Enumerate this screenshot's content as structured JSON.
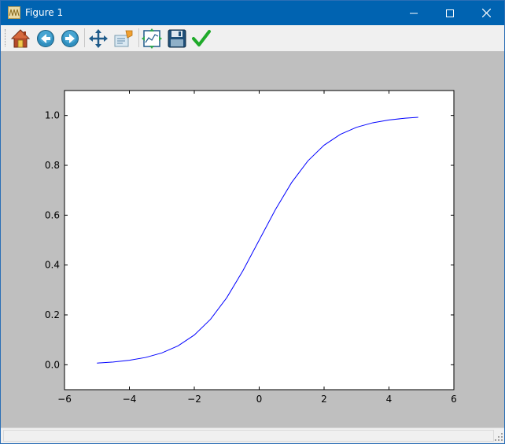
{
  "window": {
    "title": "Figure 1",
    "titlebar_color": "#0063b1",
    "icons": {
      "app": "figure-app-icon",
      "minimize": "minimize-icon",
      "maximize": "maximize-icon",
      "close": "close-icon"
    }
  },
  "toolbar": {
    "tools": [
      {
        "id": "home",
        "icon": "home-icon"
      },
      {
        "id": "back",
        "icon": "back-arrow-icon"
      },
      {
        "id": "forward",
        "icon": "forward-arrow-icon"
      },
      {
        "id": "pan",
        "icon": "pan-move-icon"
      },
      {
        "id": "zoom",
        "icon": "zoom-rectangle-icon"
      },
      {
        "id": "subplots",
        "icon": "configure-subplots-icon"
      },
      {
        "id": "save",
        "icon": "save-floppy-icon"
      },
      {
        "id": "edit",
        "icon": "edit-parameters-check-icon"
      }
    ]
  },
  "figure": {
    "background": "#bfbfbf",
    "axes_background": "#ffffff",
    "line_color": "#0000ff"
  },
  "chart_data": {
    "type": "line",
    "title": "",
    "xlabel": "",
    "ylabel": "",
    "xlim": [
      -6,
      6
    ],
    "ylim": [
      -0.1,
      1.1
    ],
    "xticks": [
      -6,
      -4,
      -2,
      0,
      2,
      4,
      6
    ],
    "xtick_labels": [
      "−6",
      "−4",
      "−2",
      "0",
      "2",
      "4",
      "6"
    ],
    "yticks": [
      0.0,
      0.2,
      0.4,
      0.6,
      0.8,
      1.0
    ],
    "ytick_labels": [
      "0.0",
      "0.2",
      "0.4",
      "0.6",
      "0.8",
      "1.0"
    ],
    "grid": false,
    "series": [
      {
        "x": [
          -5.0,
          -4.5,
          -4.0,
          -3.5,
          -3.0,
          -2.5,
          -2.0,
          -1.5,
          -1.0,
          -0.5,
          0.0,
          0.5,
          1.0,
          1.5,
          2.0,
          2.5,
          3.0,
          3.5,
          4.0,
          4.5,
          4.9
        ],
        "y": [
          0.0067,
          0.011,
          0.018,
          0.0293,
          0.0474,
          0.0759,
          0.1192,
          0.1824,
          0.2689,
          0.3775,
          0.5,
          0.6225,
          0.7311,
          0.8176,
          0.8808,
          0.9241,
          0.9526,
          0.9707,
          0.982,
          0.989,
          0.9926
        ]
      }
    ]
  }
}
